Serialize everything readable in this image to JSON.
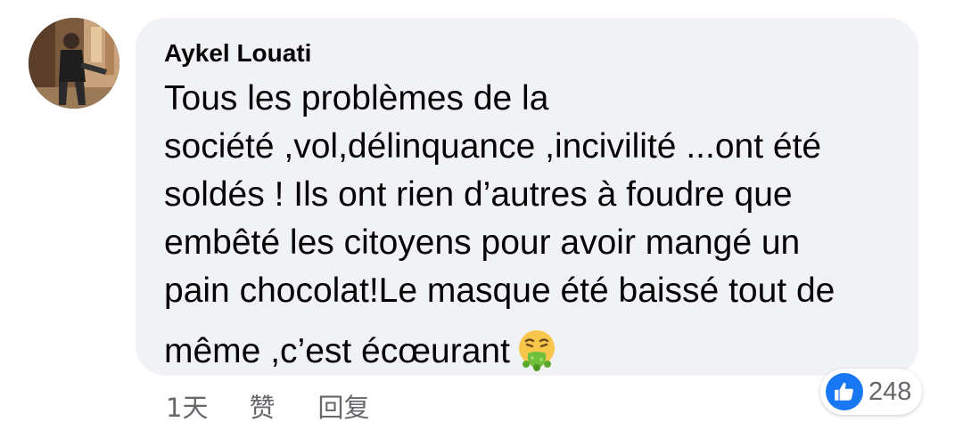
{
  "comment": {
    "author": "Aykel Louati",
    "text_lines": [
      "Tous les problèmes de la",
      "société ,vol,délinquance ,incivilité ...ont été",
      "soldés ! Ils ont rien d’autres à foudre que",
      "embêté les citoyens pour avoir mangé un",
      "pain chocolat!Le masque été baissé tout de",
      "même ,c’est écœurant"
    ],
    "emoji_icon": "vomiting-face-icon"
  },
  "actions": {
    "time": "1天",
    "like_label": "赞",
    "reply_label": "回复"
  },
  "reactions": {
    "icon": "thumbs-up-icon",
    "count": "248"
  },
  "colors": {
    "bubble": "#f0f2f5",
    "text": "#050505",
    "secondary_text": "#65676b",
    "like_blue": "#1877f2"
  }
}
